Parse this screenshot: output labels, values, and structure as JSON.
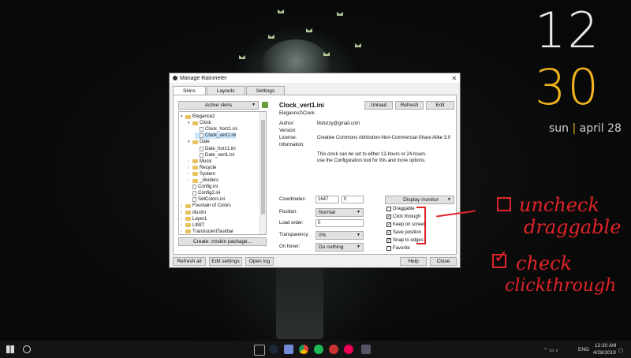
{
  "desktop": {
    "clock_hour": "12",
    "clock_minute": "30",
    "date_day": "sun",
    "date_sep": " | ",
    "date_rest": "april 28"
  },
  "window": {
    "title": "Manage Rainmeter",
    "tabs": [
      "Skins",
      "Layouts",
      "Settings"
    ],
    "active_skins_button": "Active skins",
    "create_package_button": "Create .rmskin package...",
    "tree": [
      {
        "label": "Elegance2",
        "type": "folder",
        "expanded": true,
        "depth": 0
      },
      {
        "label": "Clock",
        "type": "folder",
        "expanded": true,
        "depth": 1
      },
      {
        "label": "Clock_horz1.ini",
        "type": "file",
        "depth": 2
      },
      {
        "label": "Clock_vert1.ini",
        "type": "file",
        "depth": 2,
        "selected": true
      },
      {
        "label": "Date",
        "type": "folder",
        "expanded": true,
        "depth": 1
      },
      {
        "label": "Date_horz1.ini",
        "type": "file",
        "depth": 2
      },
      {
        "label": "Date_vert1.ini",
        "type": "file",
        "depth": 2
      },
      {
        "label": "Music",
        "type": "folder",
        "depth": 1
      },
      {
        "label": "Recycle",
        "type": "folder",
        "depth": 1
      },
      {
        "label": "System",
        "type": "folder",
        "depth": 1
      },
      {
        "label": "_dividers",
        "type": "folder",
        "depth": 1
      },
      {
        "label": "Config.ini",
        "type": "file",
        "depth": 1
      },
      {
        "label": "Config2.ini",
        "type": "file",
        "depth": 1
      },
      {
        "label": "SetColors.ini",
        "type": "file",
        "depth": 1
      },
      {
        "label": "Fountain of Colors",
        "type": "folder",
        "depth": 0
      },
      {
        "label": "illustro",
        "type": "folder",
        "depth": 0
      },
      {
        "label": "Layer1",
        "type": "folder",
        "depth": 0
      },
      {
        "label": "LIMIT",
        "type": "folder",
        "depth": 0
      },
      {
        "label": "TranslucentTaskbar",
        "type": "folder",
        "depth": 0
      }
    ],
    "skin_name": "Clock_vert1.ini",
    "skin_path": "Elegance2\\Clock",
    "buttons": {
      "unload": "Unload",
      "refresh": "Refresh",
      "edit": "Edit"
    },
    "info": [
      {
        "label": "Author:",
        "value": "lilshizzy@gmail.com"
      },
      {
        "label": "Version:",
        "value": ""
      },
      {
        "label": "License:",
        "value": "Creative Commons Attribution-Non-Commercial-Share Alike 3.0"
      },
      {
        "label": "Information:",
        "value": ""
      }
    ],
    "info_text_line1": "This clock can be set to either 12-hours or 24-hours.",
    "info_text_line2": "use the Configuration tool for this and more options.",
    "coordinates_label": "Coordinates:",
    "coord_x": "1647",
    "coord_y": "0",
    "display_monitor": "Display monitor",
    "position_label": "Position:",
    "position_value": "Normal",
    "load_order_label": "Load order:",
    "load_order_value": "0",
    "transparency_label": "Transparency:",
    "transparency_value": "0%",
    "on_hover_label": "On hover:",
    "on_hover_value": "Do nothing",
    "checkboxes": [
      {
        "label": "Draggable",
        "checked": false
      },
      {
        "label": "Click through",
        "checked": true
      },
      {
        "label": "Keep on screen",
        "checked": true
      },
      {
        "label": "Save position",
        "checked": true
      },
      {
        "label": "Snap to edges",
        "checked": true
      },
      {
        "label": "Favorite",
        "checked": false
      }
    ],
    "footer": {
      "refresh_all": "Refresh all",
      "edit_settings": "Edit settings",
      "open_log": "Open log",
      "help": "Help",
      "close": "Close"
    }
  },
  "annotations": {
    "note1_line1": "uncheck",
    "note1_line2": "draggable",
    "note2_line1": "check",
    "note2_line2": "clickthrough",
    "color": "#e0242a"
  },
  "taskbar": {
    "lang": "ENG",
    "time": "12:30 AM",
    "date": "4/28/2019",
    "apps": [
      "task-view",
      "steam",
      "discord",
      "chrome",
      "spotify",
      "rainmeter-red",
      "mail",
      "rainmeter"
    ]
  },
  "colors": {
    "accent": "#f0b31e",
    "selection": "#cde8ff"
  }
}
